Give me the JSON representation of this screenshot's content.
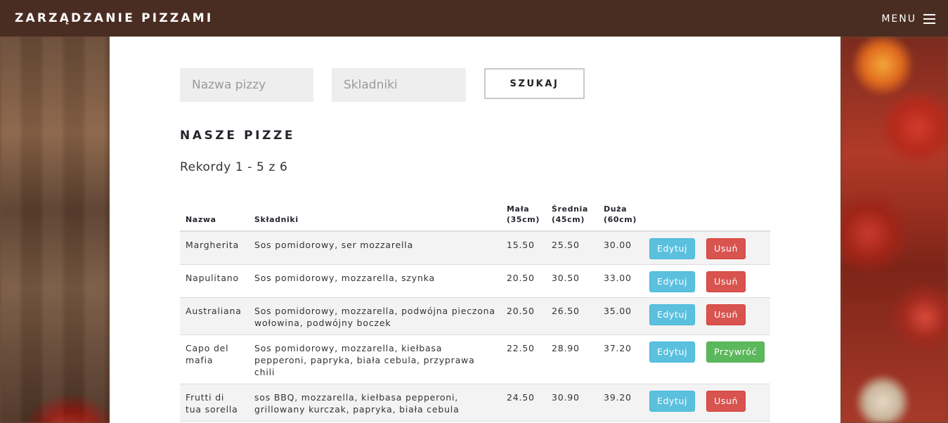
{
  "header": {
    "brand": "ZARZĄDZANIE PIZZAMI",
    "menu_label": "MENU"
  },
  "search": {
    "name_placeholder": "Nazwa pizzy",
    "ingredients_placeholder": "Skladniki",
    "button_label": "SZUKAJ"
  },
  "section_title": "NASZE PIZZE",
  "records_text": "Rekordy 1 - 5 z 6",
  "table": {
    "headers": {
      "name": "Nazwa",
      "ingredients": "Składniki",
      "small_1": "Mała",
      "small_2": "(35cm)",
      "medium_1": "Średnia",
      "medium_2": "(45cm)",
      "large_1": "Duża",
      "large_2": "(60cm)"
    },
    "rows": [
      {
        "name": "Margherita",
        "ingredients": "Sos pomidorowy, ser mozzarella",
        "small": "15.50",
        "medium": "25.50",
        "large": "30.00",
        "edit_label": "Edytuj",
        "action_label": "Usuń",
        "action_type": "delete"
      },
      {
        "name": "Napulitano",
        "ingredients": "Sos pomidorowy, mozzarella, szynka",
        "small": "20.50",
        "medium": "30.50",
        "large": "33.00",
        "edit_label": "Edytuj",
        "action_label": "Usuń",
        "action_type": "delete"
      },
      {
        "name": "Australiana",
        "ingredients": "Sos pomidorowy, mozzarella, podwójna pieczona wołowina, podwójny boczek",
        "small": "20.50",
        "medium": "26.50",
        "large": "35.00",
        "edit_label": "Edytuj",
        "action_label": "Usuń",
        "action_type": "delete"
      },
      {
        "name": "Capo del mafia",
        "ingredients": "Sos pomidorowy, mozzarella, kiełbasa pepperoni, papryka, biała cebula, przyprawa chili",
        "small": "22.50",
        "medium": "28.90",
        "large": "37.20",
        "edit_label": "Edytuj",
        "action_label": "Przywróć",
        "action_type": "restore"
      },
      {
        "name": "Frutti di tua sorella",
        "ingredients": "sos BBQ, mozzarella, kiełbasa pepperoni, grillowany kurczak, papryka, biała cebula",
        "small": "24.50",
        "medium": "30.90",
        "large": "39.20",
        "edit_label": "Edytuj",
        "action_label": "Usuń",
        "action_type": "delete"
      }
    ]
  },
  "colors": {
    "header_bg": "#4a2d22",
    "edit": "#5bc0de",
    "delete": "#d9534f",
    "restore": "#5cb85c"
  }
}
